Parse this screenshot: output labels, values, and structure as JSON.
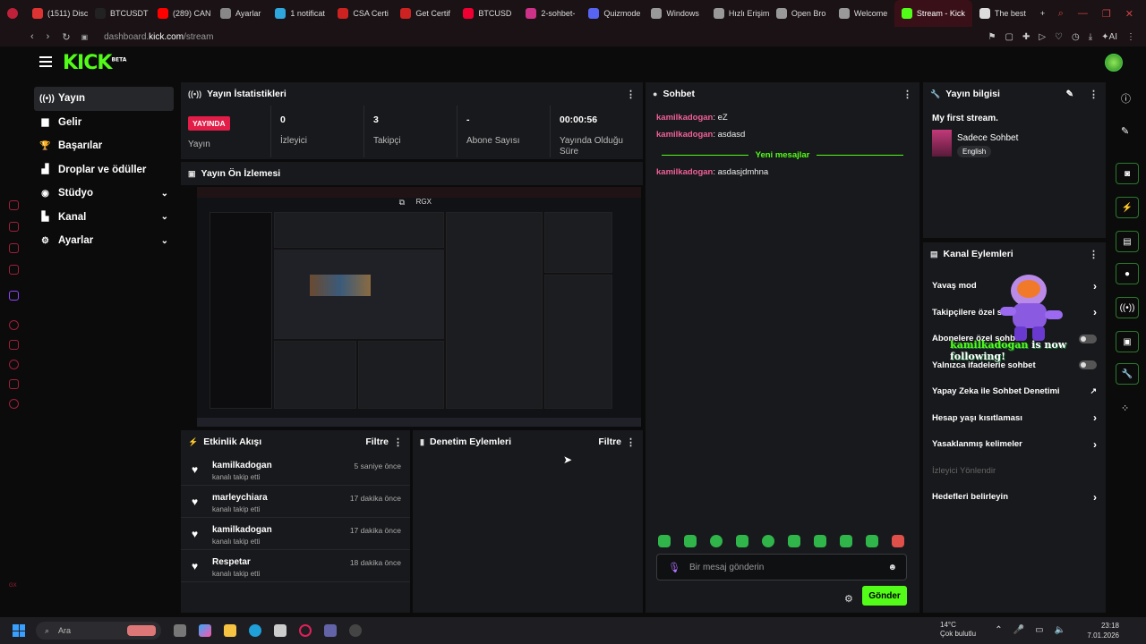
{
  "browser": {
    "tabs": [
      {
        "label": "(1511) Disc",
        "color": "#d33"
      },
      {
        "label": "BTCUSDT",
        "color": "#222"
      },
      {
        "label": "(289) CAN",
        "color": "#f00"
      },
      {
        "label": "Ayarlar",
        "color": "#888"
      },
      {
        "label": "1 notificat",
        "color": "#2ea6de"
      },
      {
        "label": "CSA Certi",
        "color": "#c22"
      },
      {
        "label": "Get Certif",
        "color": "#c22"
      },
      {
        "label": "BTCUSD",
        "color": "#e03"
      },
      {
        "label": "2-sohbet-",
        "color": "#c38"
      },
      {
        "label": "Quizmode",
        "color": "#5865f2"
      },
      {
        "label": "Windows",
        "color": "#999"
      },
      {
        "label": "Hızlı Erişim",
        "color": "#999"
      },
      {
        "label": "Open Bro",
        "color": "#999"
      },
      {
        "label": "Welcome",
        "color": "#999"
      },
      {
        "label": "Stream - Kick",
        "color": "#53fc18",
        "active": true
      },
      {
        "label": "The best",
        "color": "#ddd"
      }
    ],
    "url_prefix": "dashboard.",
    "url_domain": "kick.com",
    "url_path": "/stream"
  },
  "header": {
    "logo": "KICK",
    "logo_badge": "BETA"
  },
  "sidebar": {
    "items": [
      {
        "label": "Yayın",
        "icon": "broadcast-icon",
        "glyph": "((•))"
      },
      {
        "label": "Gelir",
        "icon": "chart-icon",
        "glyph": "▆"
      },
      {
        "label": "Başarılar",
        "icon": "trophy-icon",
        "glyph": "🏆"
      },
      {
        "label": "Droplar ve ödüller",
        "icon": "gift-icon",
        "glyph": "▟"
      },
      {
        "label": "Stüdyo",
        "icon": "studio-icon",
        "glyph": "◉"
      },
      {
        "label": "Kanal",
        "icon": "channel-icon",
        "glyph": "▙"
      },
      {
        "label": "Ayarlar",
        "icon": "settings-icon",
        "glyph": "⚙"
      }
    ]
  },
  "stats": {
    "title": "Yayın İstatistikleri",
    "live_badge": "YAYINDA",
    "live_label": "Yayın",
    "viewers_value": "0",
    "viewers_label": "İzleyici",
    "followers_value": "3",
    "followers_label": "Takipçi",
    "subs_value": "-",
    "subs_label": "Abone Sayısı",
    "uptime_value": "00:00:56",
    "uptime_label": "Yayında Olduğu Süre"
  },
  "preview": {
    "title": "Yayın Ön İzlemesi",
    "overlay_label": "RGX"
  },
  "activity": {
    "title": "Etkinlik Akışı",
    "filter": "Filtre",
    "items": [
      {
        "user": "kamilkadogan",
        "action": "kanalı takip etti",
        "time": "5 saniye önce"
      },
      {
        "user": "marleychiara",
        "action": "kanalı takip etti",
        "time": "17 dakika önce"
      },
      {
        "user": "kamilkadogan",
        "action": "kanalı takip etti",
        "time": "17 dakika önce"
      },
      {
        "user": "Respetar",
        "action": "kanalı takip etti",
        "time": "18 dakika önce"
      }
    ]
  },
  "moderation": {
    "title": "Denetim Eylemleri",
    "filter": "Filtre"
  },
  "chat": {
    "title": "Sohbet",
    "messages": [
      {
        "user": "kamilkadogan",
        "text": "eZ"
      },
      {
        "user": "kamilkadogan",
        "text": "asdasd"
      }
    ],
    "new_divider": "Yeni mesajlar",
    "new_messages": [
      {
        "user": "kamilkadogan",
        "text": "asdasjdmhna"
      }
    ],
    "input_placeholder": "Bir mesaj gönderin",
    "send_label": "Gönder"
  },
  "stream_info": {
    "title": "Yayın bilgisi",
    "stream_title": "My first stream.",
    "category": "Sadece Sohbet",
    "language": "English"
  },
  "channel_actions": {
    "title": "Kanal Eylemleri",
    "items": [
      {
        "label": "Yavaş mod",
        "control": "arrow"
      },
      {
        "label": "Takipçilere özel sohbet",
        "control": "arrow"
      },
      {
        "label": "Abonelere özel sohbet",
        "control": "toggle"
      },
      {
        "label": "Yalnızca ifadelerle sohbet",
        "control": "toggle"
      },
      {
        "label": "Yapay Zeka ile Sohbet Denetimi",
        "control": "external"
      },
      {
        "label": "Hesap yaşı kısıtlaması",
        "control": "arrow"
      },
      {
        "label": "Yasaklanmış kelimeler",
        "control": "arrow"
      },
      {
        "label": "İzleyici Yönlendir",
        "control": "disabled"
      },
      {
        "label": "Hedefleri belirleyin",
        "control": "arrow"
      }
    ],
    "follow_alert_user": "kamilkadogan",
    "follow_alert_text": " is now following!"
  },
  "taskbar": {
    "search": "Ara",
    "weather_temp": "14°C",
    "weather_desc": "Çok bulutlu",
    "time": "23:18",
    "date": "7.01.2026"
  }
}
